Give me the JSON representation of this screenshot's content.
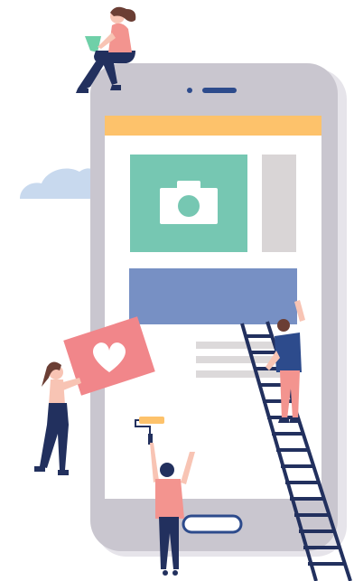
{
  "illustration": {
    "kind": "app-building-illustration",
    "colors": {
      "phone_body": "#c9c6cf",
      "phone_shadow": "#e6e4ea",
      "screen": "#ffffff",
      "app_header": "#fdc26b",
      "image_card": "#76c7b2",
      "side_card": "#d9d5d6",
      "banner": "#7790c4",
      "text_lines": "#dcd9da",
      "heart_card": "#f1868a",
      "cloud": "#c8d9ee",
      "navy": "#22305e",
      "pink_shirt": "#f3948f",
      "hair": "#6b3e34",
      "skin": "#f8c4b4"
    },
    "icons": [
      "camera-icon",
      "heart-icon"
    ],
    "figures": [
      "person-with-laptop",
      "person-holding-heart-card",
      "person-painting-with-roller",
      "person-on-ladder"
    ]
  }
}
